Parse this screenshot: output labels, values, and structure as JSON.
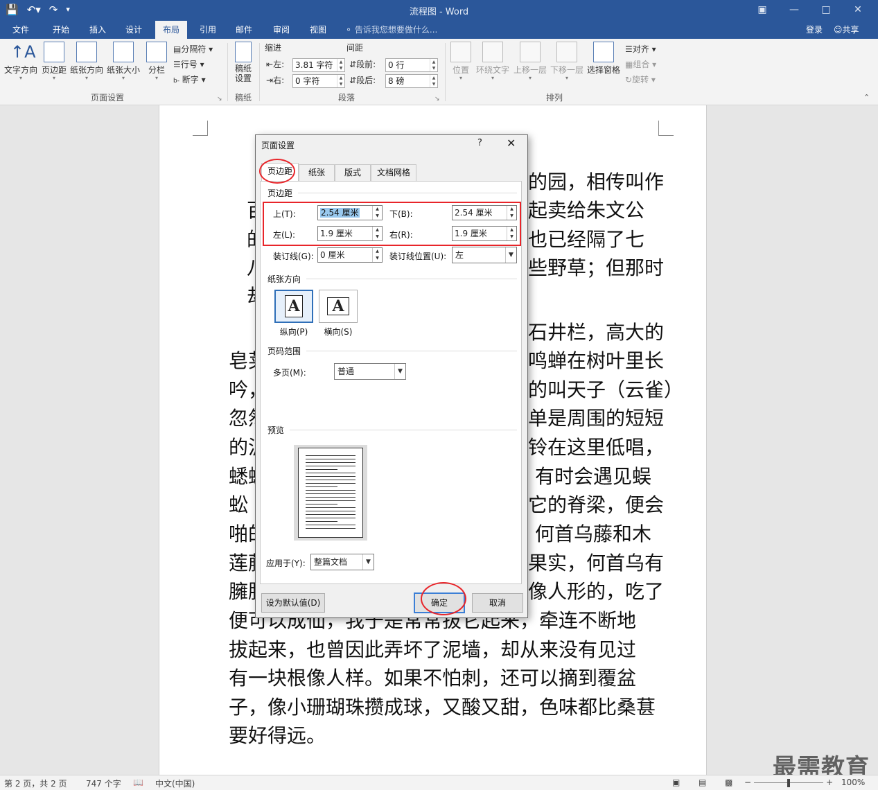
{
  "window": {
    "title": "流程图 - Word"
  },
  "tabs": [
    "文件",
    "开始",
    "插入",
    "设计",
    "布局",
    "引用",
    "邮件",
    "审阅",
    "视图"
  ],
  "tell_me": "告诉我您想要做什么...",
  "login": "登录",
  "share": "共享",
  "ribbon": {
    "page_setup": {
      "text_direction": "文字方向",
      "margins": "页边距",
      "orientation": "纸张方向",
      "size": "纸张大小",
      "columns": "分栏",
      "breaks": "分隔符",
      "line_numbers": "行号",
      "hyphenation": "断字",
      "group_label": "页面设置"
    },
    "manuscript": {
      "settings": "稿纸设置",
      "group_label": "稿纸"
    },
    "paragraph": {
      "indent_label": "缩进",
      "spacing_label": "间距",
      "left_label": "左:",
      "left_value": "3.81 字符",
      "right_label": "右:",
      "right_value": "0 字符",
      "before_label": "段前:",
      "before_value": "0 行",
      "after_label": "段后:",
      "after_value": "8 磅",
      "group_label": "段落"
    },
    "arrange": {
      "position": "位置",
      "wrap_text": "环绕文字",
      "bring_forward": "上移一层",
      "send_backward": "下移一层",
      "selection_pane": "选择窗格",
      "align": "对齐",
      "group": "组合",
      "rotate": "旋转",
      "group_label": "排列"
    }
  },
  "document": {
    "lines": [
      "百",
      "的",
      "八",
      "却",
      "皂荚",
      "吟，",
      "忽然",
      "的泥",
      "蟋蟀",
      "蚣",
      "啪的",
      "莲藤",
      "臃肿",
      "便可以成仙，我于是常常拔它起来，牵连不断地",
      "拔起来，也曾因此弄坏了泥墙，却从来没有见过",
      "有一块根像人样。如果不怕刺，还可以摘到覆盆",
      "子，像小珊瑚珠攒成球，又酸又甜，色味都比桑葚",
      "要好得远。"
    ],
    "right_lines": [
      "的园，相传叫作",
      "起卖给朱文公",
      "也已经隔了七",
      "些野草；但那时",
      "石井栏，高大的",
      "鸣蝉在树叶里长",
      "的叫天子（云雀）",
      "单是周围的短短",
      "铃在这里低唱，",
      "有时会遇见蜈",
      "它的脊梁，便会",
      "何首乌藤和木",
      "果实，何首乌有",
      "像人形的，吃了"
    ]
  },
  "dialog": {
    "title": "页面设置",
    "help": "?",
    "close": "✕",
    "tabs": [
      "页边距",
      "纸张",
      "版式",
      "文档网格"
    ],
    "margins_section": "页边距",
    "top_label": "上(T):",
    "top_value": "2.54 厘米",
    "bottom_label": "下(B):",
    "bottom_value": "2.54 厘米",
    "left_label": "左(L):",
    "left_value": "1.9 厘米",
    "right_label": "右(R):",
    "right_value": "1.9 厘米",
    "gutter_label": "装订线(G):",
    "gutter_value": "0 厘米",
    "gutter_pos_label": "装订线位置(U):",
    "gutter_pos_value": "左",
    "orientation_section": "纸张方向",
    "portrait": "纵向(P)",
    "landscape": "横向(S)",
    "pages_section": "页码范围",
    "multiple_pages_label": "多页(M):",
    "multiple_pages_value": "普通",
    "preview_section": "预览",
    "apply_to_label": "应用于(Y):",
    "apply_to_value": "整篇文档",
    "set_default": "设为默认值(D)",
    "ok": "确定",
    "cancel": "取消"
  },
  "status": {
    "page": "第 2 页，共 2 页",
    "words": "747 个字",
    "language": "中文(中国)",
    "zoom": "100%"
  },
  "watermark": "最需教育",
  "colors": {
    "word_blue": "#2b579a",
    "annotation_red": "#e8252a",
    "selection": "#99c9ef"
  }
}
